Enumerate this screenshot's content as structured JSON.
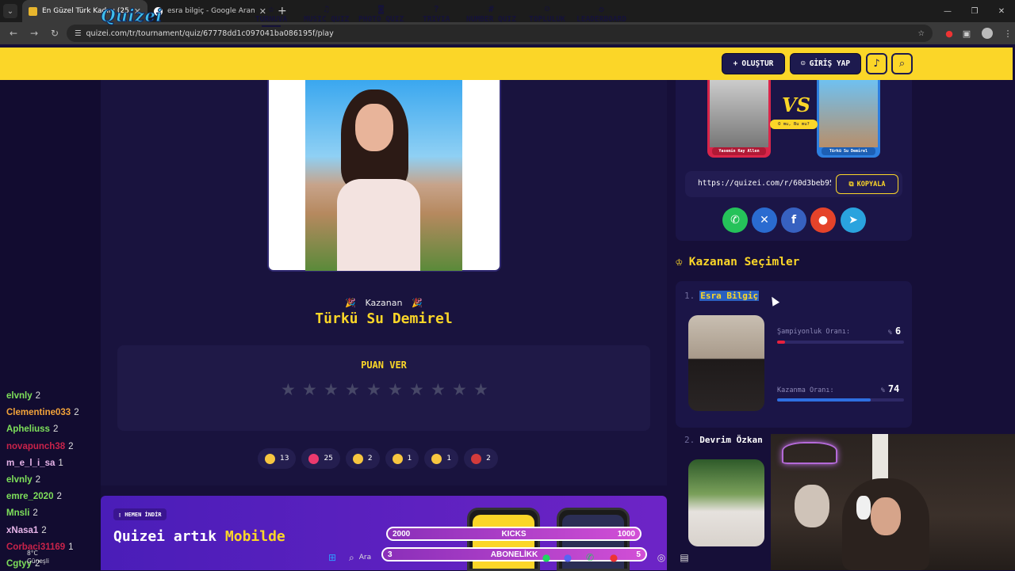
{
  "browser": {
    "tabs": [
      {
        "title": "En Güzel Türk Kadını (256 Kişi)",
        "active": true
      },
      {
        "title": "esra bilgiç - Google Arama",
        "active": false
      }
    ],
    "url": "quizei.com/tr/tournament/quiz/67778dd1c097041ba086195f/play"
  },
  "site": {
    "logo": "Quizei",
    "nav": [
      {
        "label": "TURNUVA",
        "icon": "trophy-icon"
      },
      {
        "label": "MUSIC QUIZ",
        "icon": "music-icon"
      },
      {
        "label": "PHOTO QUIZ",
        "icon": "camera-icon"
      },
      {
        "label": "TRIVIA",
        "icon": "question-icon"
      },
      {
        "label": "NUMBER QUIZ",
        "icon": "hash-icon"
      },
      {
        "label": "TOPLULUK",
        "icon": "users-icon"
      },
      {
        "label": "LEADERBOARD",
        "icon": "award-icon"
      }
    ],
    "create_label": "OLUŞTUR",
    "login_label": "GİRİŞ YAP"
  },
  "winner": {
    "label": "Kazanan",
    "name": "Türkü Su Demirel"
  },
  "rating": {
    "title": "PUAN VER",
    "star_count": 10,
    "value": 0
  },
  "reactions": [
    {
      "emoji": "thumbs-up",
      "count": "13"
    },
    {
      "emoji": "heart",
      "count": "25"
    },
    {
      "emoji": "laugh",
      "count": "2"
    },
    {
      "emoji": "wow",
      "count": "1"
    },
    {
      "emoji": "sad",
      "count": "1"
    },
    {
      "emoji": "angry",
      "count": "2"
    }
  ],
  "promo": {
    "badge": "HEMEN İNDİR",
    "title_prefix": "Quizei artık ",
    "title_highlight": "Mobilde"
  },
  "share": {
    "vs_left_caption": "Yasemin Kay Allen",
    "vs_right_caption": "Türkü Su Demirel",
    "vs_text": "VS",
    "vs_question": "O mu, Bu mu?",
    "link": "https://quizei.com/r/60d3beb95",
    "copy_label": "KOPYALA",
    "networks": [
      "whatsapp",
      "x",
      "facebook",
      "reddit",
      "telegram"
    ]
  },
  "selections": {
    "title": "Kazanan Seçimler",
    "items": [
      {
        "rank": "1.",
        "name": "Esra Bilgiç",
        "champ_label": "Şampiyonluk Oranı:",
        "champ_value": "6",
        "champ_pct": 6,
        "win_label": "Kazanma Oranı:",
        "win_value": "74",
        "win_pct": 74
      },
      {
        "rank": "2.",
        "name": "Devrim Özkan"
      }
    ]
  },
  "chat": [
    {
      "user": "elvnly",
      "count": "2",
      "color": "#7ee05a"
    },
    {
      "user": "Clementine033",
      "count": "2",
      "color": "#f2a33a"
    },
    {
      "user": "Apheliuss",
      "count": "2",
      "color": "#7ee05a"
    },
    {
      "user": "novapunch38",
      "count": "2",
      "color": "#c9234a"
    },
    {
      "user": "m_e_l_i_sa",
      "count": "1",
      "color": "#e6b4e8"
    },
    {
      "user": "elvnly",
      "count": "2",
      "color": "#7ee05a"
    },
    {
      "user": "emre_2020",
      "count": "2",
      "color": "#7ee05a"
    },
    {
      "user": "Mnsli",
      "count": "2",
      "color": "#7ee05a"
    },
    {
      "user": "xNasa1",
      "count": "2",
      "color": "#e6b4e8"
    },
    {
      "user": "Corbaci31169",
      "count": "1",
      "color": "#c9234a"
    },
    {
      "user": "Cgtyy",
      "count": "2",
      "color": "#7ee05a"
    }
  ],
  "overlay": {
    "kicks_left": "2000",
    "kicks_label": "KICKS",
    "kicks_right": "1000",
    "subs_left": "3",
    "subs_label": "ABONELİKK",
    "subs_right": "5"
  },
  "taskbar": {
    "search": "Ara",
    "weather_temp": "8°C",
    "weather_desc": "Güneşli"
  },
  "colors": {
    "header_yellow": "#fbd628",
    "page_bg": "#160f38",
    "accent_blue": "#2a5fc0"
  }
}
